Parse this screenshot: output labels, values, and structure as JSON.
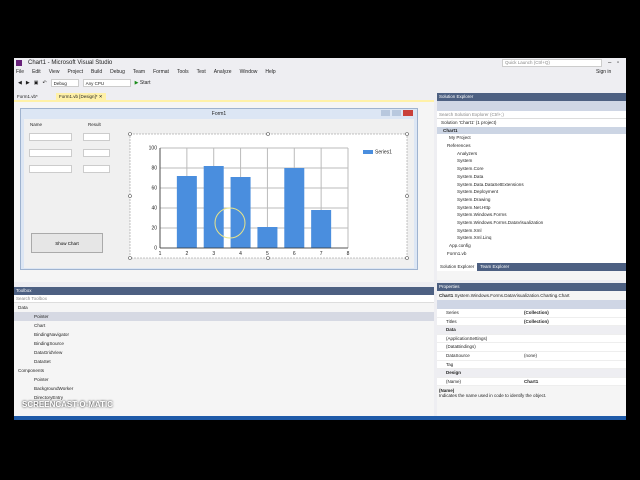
{
  "window": {
    "title": "Chart1 - Microsoft Visual Studio",
    "sign_in": "Sign in",
    "quick_launch_placeholder": "Quick Launch (Ctrl+Q)"
  },
  "menu": [
    "File",
    "Edit",
    "View",
    "Project",
    "Build",
    "Debug",
    "Team",
    "Format",
    "Tools",
    "Test",
    "Analyze",
    "Window",
    "Help"
  ],
  "toolbar": {
    "config": "Debug",
    "platform": "Any CPU",
    "start": "Start"
  },
  "doc_tabs": [
    {
      "label": "Form1.vb*"
    },
    {
      "label": "Form1.vb [Design]*"
    }
  ],
  "form": {
    "title": "Form1",
    "name_label": "Name",
    "result_label": "Result",
    "show_chart_button": "Show Chart"
  },
  "chart_data": {
    "type": "bar",
    "categories": [
      2,
      3,
      4,
      5,
      6,
      7
    ],
    "values": [
      72,
      82,
      71,
      21,
      80,
      38
    ],
    "x_ticks": [
      "1",
      "2",
      "3",
      "4",
      "5",
      "6",
      "7",
      "8"
    ],
    "y_ticks": [
      "0",
      "20",
      "40",
      "60",
      "80",
      "100"
    ],
    "xlim": [
      1,
      8
    ],
    "ylim": [
      0,
      100
    ],
    "legend": "Series1",
    "legend_placement": "top-right",
    "series_color": "#4a8ede",
    "grid": true
  },
  "solution_explorer": {
    "title": "Solution Explorer",
    "search_placeholder": "Search Solution Explorer (Ctrl+;)",
    "items": [
      "Solution 'Chart1' (1 project)",
      "Chart1",
      "My Project",
      "References",
      "Analyzers",
      "System",
      "System.Core",
      "System.Data",
      "System.Data.DataSetExtensions",
      "System.Deployment",
      "System.Drawing",
      "System.Net.Http",
      "System.Windows.Forms",
      "System.Windows.Forms.DataVisualization",
      "System.Xml",
      "System.Xml.Linq",
      "App.config",
      "Form1.vb"
    ],
    "tabs": [
      "Solution Explorer",
      "Team Explorer"
    ]
  },
  "toolbox": {
    "title": "Toolbox",
    "search_placeholder": "Search Toolbox",
    "groups": [
      {
        "name": "Data",
        "items": [
          "Pointer",
          "Chart",
          "BindingNavigator",
          "BindingSource",
          "DataGridView",
          "DataSet"
        ]
      },
      {
        "name": "Components",
        "items": [
          "Pointer",
          "BackgroundWorker",
          "DirectoryEntry"
        ]
      }
    ]
  },
  "properties": {
    "title": "Properties",
    "object": "Chart1",
    "object_type": "System.Windows.Forms.DataVisualization.Charting.Chart",
    "rows": [
      {
        "name": "Series",
        "value": "(Collection)",
        "bold": true
      },
      {
        "name": "Titles",
        "value": "(Collection)",
        "bold": true
      },
      {
        "name": "Data",
        "category": true
      },
      {
        "name": "(ApplicationSettings)",
        "value": ""
      },
      {
        "name": "(DataBindings)",
        "value": ""
      },
      {
        "name": "DataSource",
        "value": "(none)"
      },
      {
        "name": "Tag",
        "value": ""
      },
      {
        "name": "Design",
        "category": true
      },
      {
        "name": "(Name)",
        "value": "Chart1",
        "bold": true
      }
    ],
    "desc_title": "(Name)",
    "desc_text": "Indicates the name used in code to identify the object."
  },
  "watermark": "SCREENCAST-O-MATIC"
}
